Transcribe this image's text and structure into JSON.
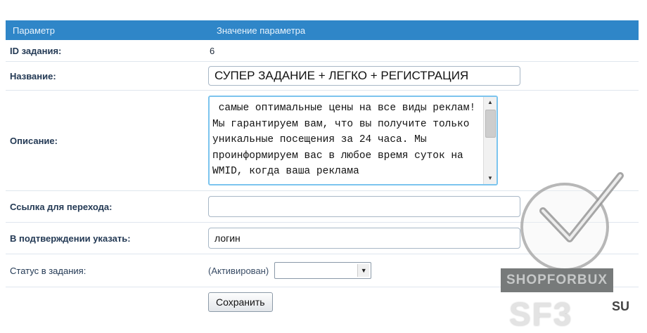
{
  "header": {
    "param_col": "Параметр",
    "value_col": "Значение параметра"
  },
  "fields": {
    "id": {
      "label": "ID задания:",
      "value": "6"
    },
    "name": {
      "label": "Название:",
      "value": "СУПЕР ЗАДАНИЕ + ЛЕГКО + РЕГИСТРАЦИЯ"
    },
    "description": {
      "label": "Описание:",
      "value": " самые оптимальные цены на все виды реклам! Мы гарантируем вам, что вы получите только уникальные посещения за 24 часа. Мы проинформируем вас в любое время суток на WMID, когда ваша реклама"
    },
    "link": {
      "label": "Ссылка для перехода:",
      "value": ""
    },
    "confirm": {
      "label": "В подтверждении указать:",
      "value": "логин"
    },
    "status": {
      "label": "Статус в задания:",
      "text": "(Активирован)",
      "selected": ""
    }
  },
  "save_label": "Сохранить",
  "watermark": {
    "banner": "SHOPFORBUX",
    "brand": "SF3",
    "tld": "SU"
  },
  "colors": {
    "header_bg": "#2f86c8",
    "textarea_border": "#7cc4ee"
  }
}
